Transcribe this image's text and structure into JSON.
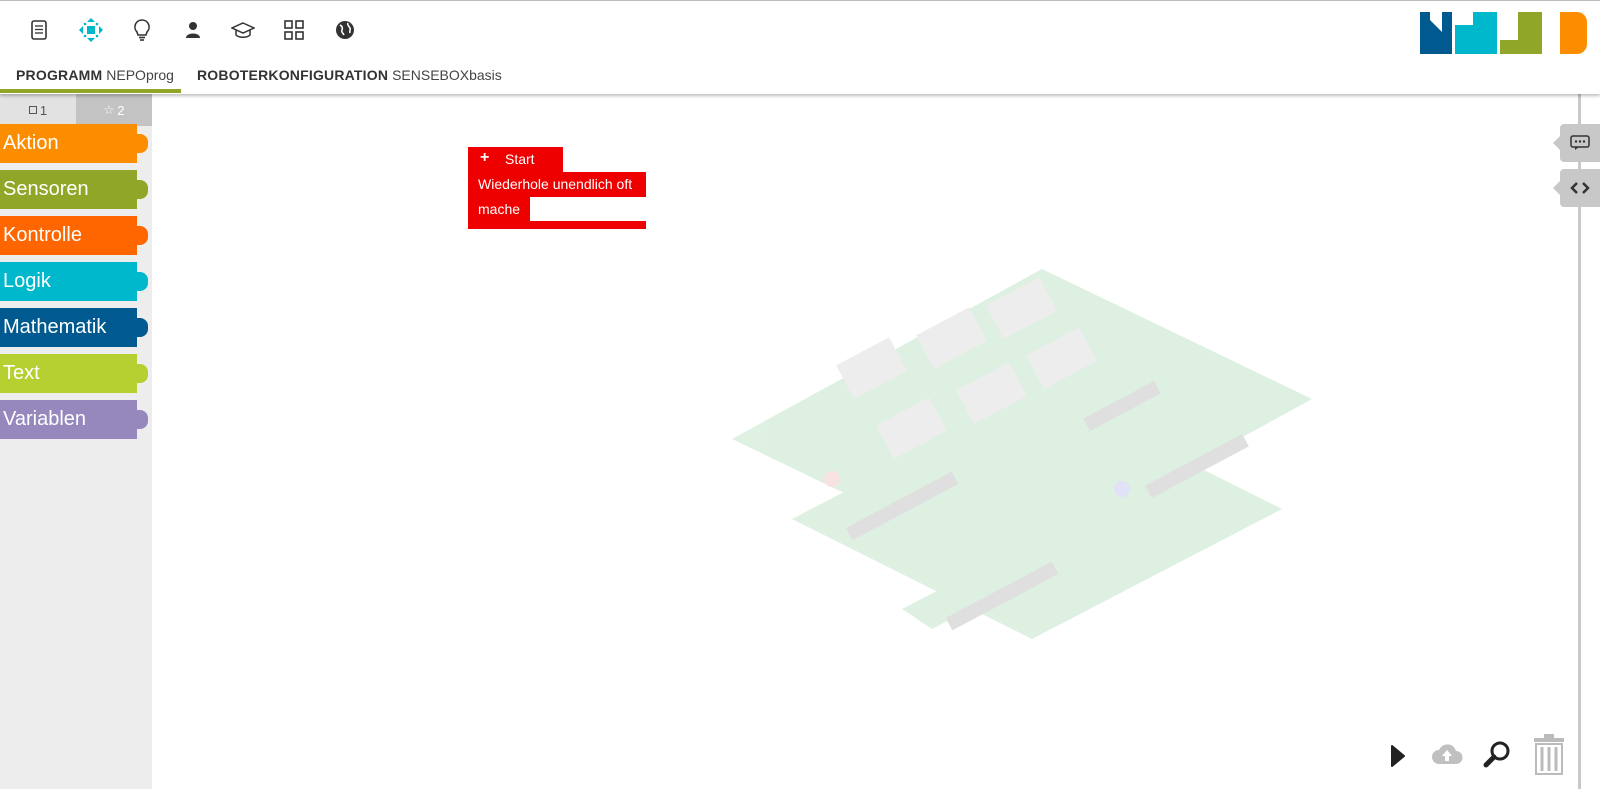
{
  "header": {
    "menu_icons": [
      "document-icon",
      "robot-connect-icon",
      "lightbulb-icon",
      "user-icon",
      "graduation-cap-icon",
      "gallery-grid-icon",
      "globe-icon"
    ],
    "tabs": [
      {
        "label_bold": "PROGRAMM",
        "value": "NEPOprog"
      },
      {
        "label_bold": "ROBOTERKONFIGURATION",
        "value": "SENSEBOXbasis"
      }
    ]
  },
  "toolbox": {
    "levels": [
      {
        "icon": "square-icon",
        "label": "1"
      },
      {
        "icon": "star-icon",
        "label": "2"
      }
    ],
    "categories": [
      {
        "label": "Aktion",
        "color": "#fd8d00"
      },
      {
        "label": "Sensoren",
        "color": "#8fa628"
      },
      {
        "label": "Kontrolle",
        "color": "#ff6600"
      },
      {
        "label": "Logik",
        "color": "#00b8cc"
      },
      {
        "label": "Mathematik",
        "color": "#005a8f"
      },
      {
        "label": "Text",
        "color": "#b6cf31"
      },
      {
        "label": "Variablen",
        "color": "#9688bd"
      }
    ]
  },
  "blocks": {
    "start_label": "Start",
    "loop_label": "Wiederhole unendlich oft",
    "do_label": "mache",
    "color": "#ee0000"
  },
  "side_buttons": [
    "comment-icon",
    "code-view-icon"
  ],
  "bottom_tools": [
    "run-icon",
    "upload-cloud-icon",
    "zoom-icon",
    "trash-icon"
  ],
  "logo_colors": [
    "#005a8f",
    "#00b8cc",
    "#8fa628",
    "#fd8d00"
  ]
}
